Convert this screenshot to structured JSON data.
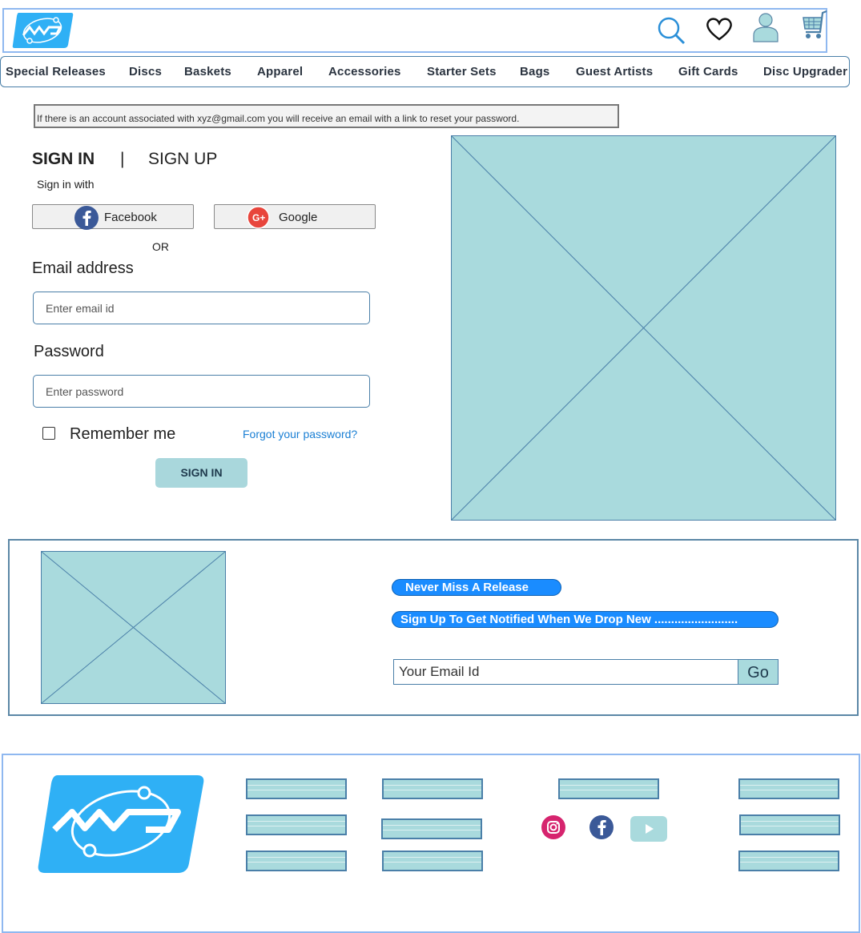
{
  "header": {
    "logo_icon": "mvp-logo",
    "icons": [
      "search-icon",
      "heart-icon",
      "user-icon",
      "cart-icon"
    ]
  },
  "nav": {
    "items": [
      "Special Releases",
      "Discs",
      "Baskets",
      "Apparel",
      "Accessories",
      "Starter Sets",
      "Bags",
      "Guest Artists",
      "Gift Cards",
      "Disc Upgrader"
    ]
  },
  "notice": "If there is an account associated with xyz@gmail.com you will receive an email with a link to reset your password.",
  "auth": {
    "tab_signin": "SIGN IN",
    "tab_separator": "|",
    "tab_signup": "SIGN UP",
    "sign_in_with": "Sign in with",
    "facebook_label": "Facebook",
    "google_label": "Google",
    "or": "OR",
    "email_label": "Email  address",
    "email_placeholder": "Enter email id",
    "password_label": "Password",
    "password_placeholder": "Enter password",
    "remember_label": "Remember me",
    "forgot_label": "Forgot your password?",
    "signin_button": "SIGN IN"
  },
  "newsletter": {
    "pill1": "Never Miss A Release",
    "pill2": "Sign Up To Get Notified When We Drop New .........................",
    "email_placeholder": "Your Email Id",
    "go_label": "Go"
  },
  "footer": {
    "social": [
      "instagram-icon",
      "facebook-icon",
      "youtube-icon"
    ]
  },
  "colors": {
    "accent": "#1a8cff",
    "placeholder_fill": "#a9dadd",
    "border_blue": "#4a7fa8",
    "logo_blue": "#2fb0f5",
    "link_blue": "#1a7fd4"
  }
}
